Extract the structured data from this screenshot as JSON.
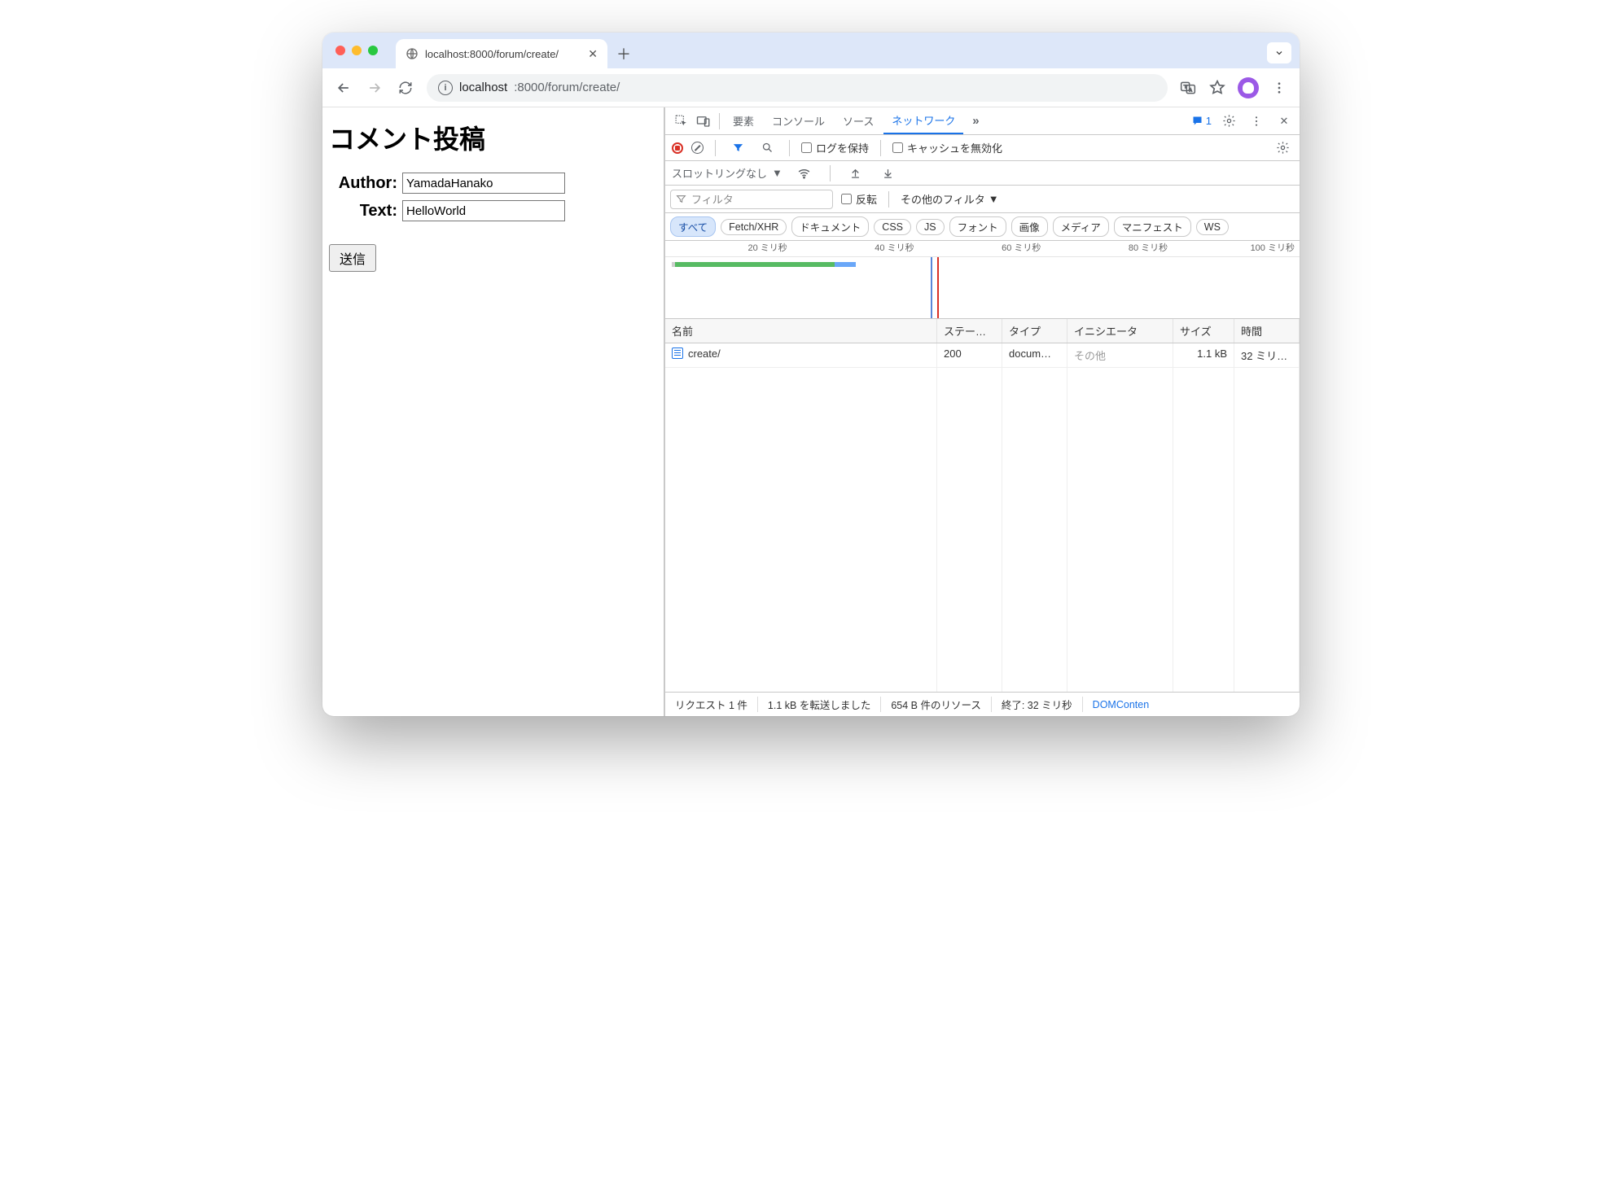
{
  "chrome": {
    "tab_title": "localhost:8000/forum/create/",
    "url_host": "localhost",
    "url_port_path": ":8000/forum/create/"
  },
  "page": {
    "heading": "コメント投稿",
    "author_label": "Author:",
    "author_value": "YamadaHanako",
    "text_label": "Text:",
    "text_value": "HelloWorld",
    "submit": "送信"
  },
  "dt": {
    "tabs": {
      "elements": "要素",
      "console": "コンソール",
      "sources": "ソース",
      "network": "ネットワーク"
    },
    "issues_count": "1",
    "bar": {
      "preserve": "ログを保持",
      "disable_cache": "キャッシュを無効化"
    },
    "bar2": {
      "throttling": "スロットリングなし"
    },
    "filter": {
      "placeholder": "フィルタ",
      "invert": "反転",
      "other": "その他のフィルタ"
    },
    "chips": {
      "all": "すべて",
      "fetch": "Fetch/XHR",
      "doc": "ドキュメント",
      "css": "CSS",
      "js": "JS",
      "font": "フォント",
      "img": "画像",
      "media": "メディア",
      "manifest": "マニフェスト",
      "ws": "WS"
    },
    "tl_ticks": {
      "t1": "20 ミリ秒",
      "t2": "40 ミリ秒",
      "t3": "60 ミリ秒",
      "t4": "80 ミリ秒",
      "t5": "100 ミリ秒"
    },
    "cols": {
      "name": "名前",
      "status": "ステー…",
      "type": "タイプ",
      "initiator": "イニシエータ",
      "size": "サイズ",
      "time": "時間"
    },
    "row": {
      "name": "create/",
      "status": "200",
      "type": "docum…",
      "initiator": "その他",
      "size": "1.1 kB",
      "time": "32 ミリ…"
    },
    "status": {
      "req": "リクエスト 1 件",
      "xfer": "1.1 kB を転送しました",
      "res": "654 B 件のリソース",
      "fin": "終了: 32 ミリ秒",
      "dom": "DOMConten"
    }
  }
}
